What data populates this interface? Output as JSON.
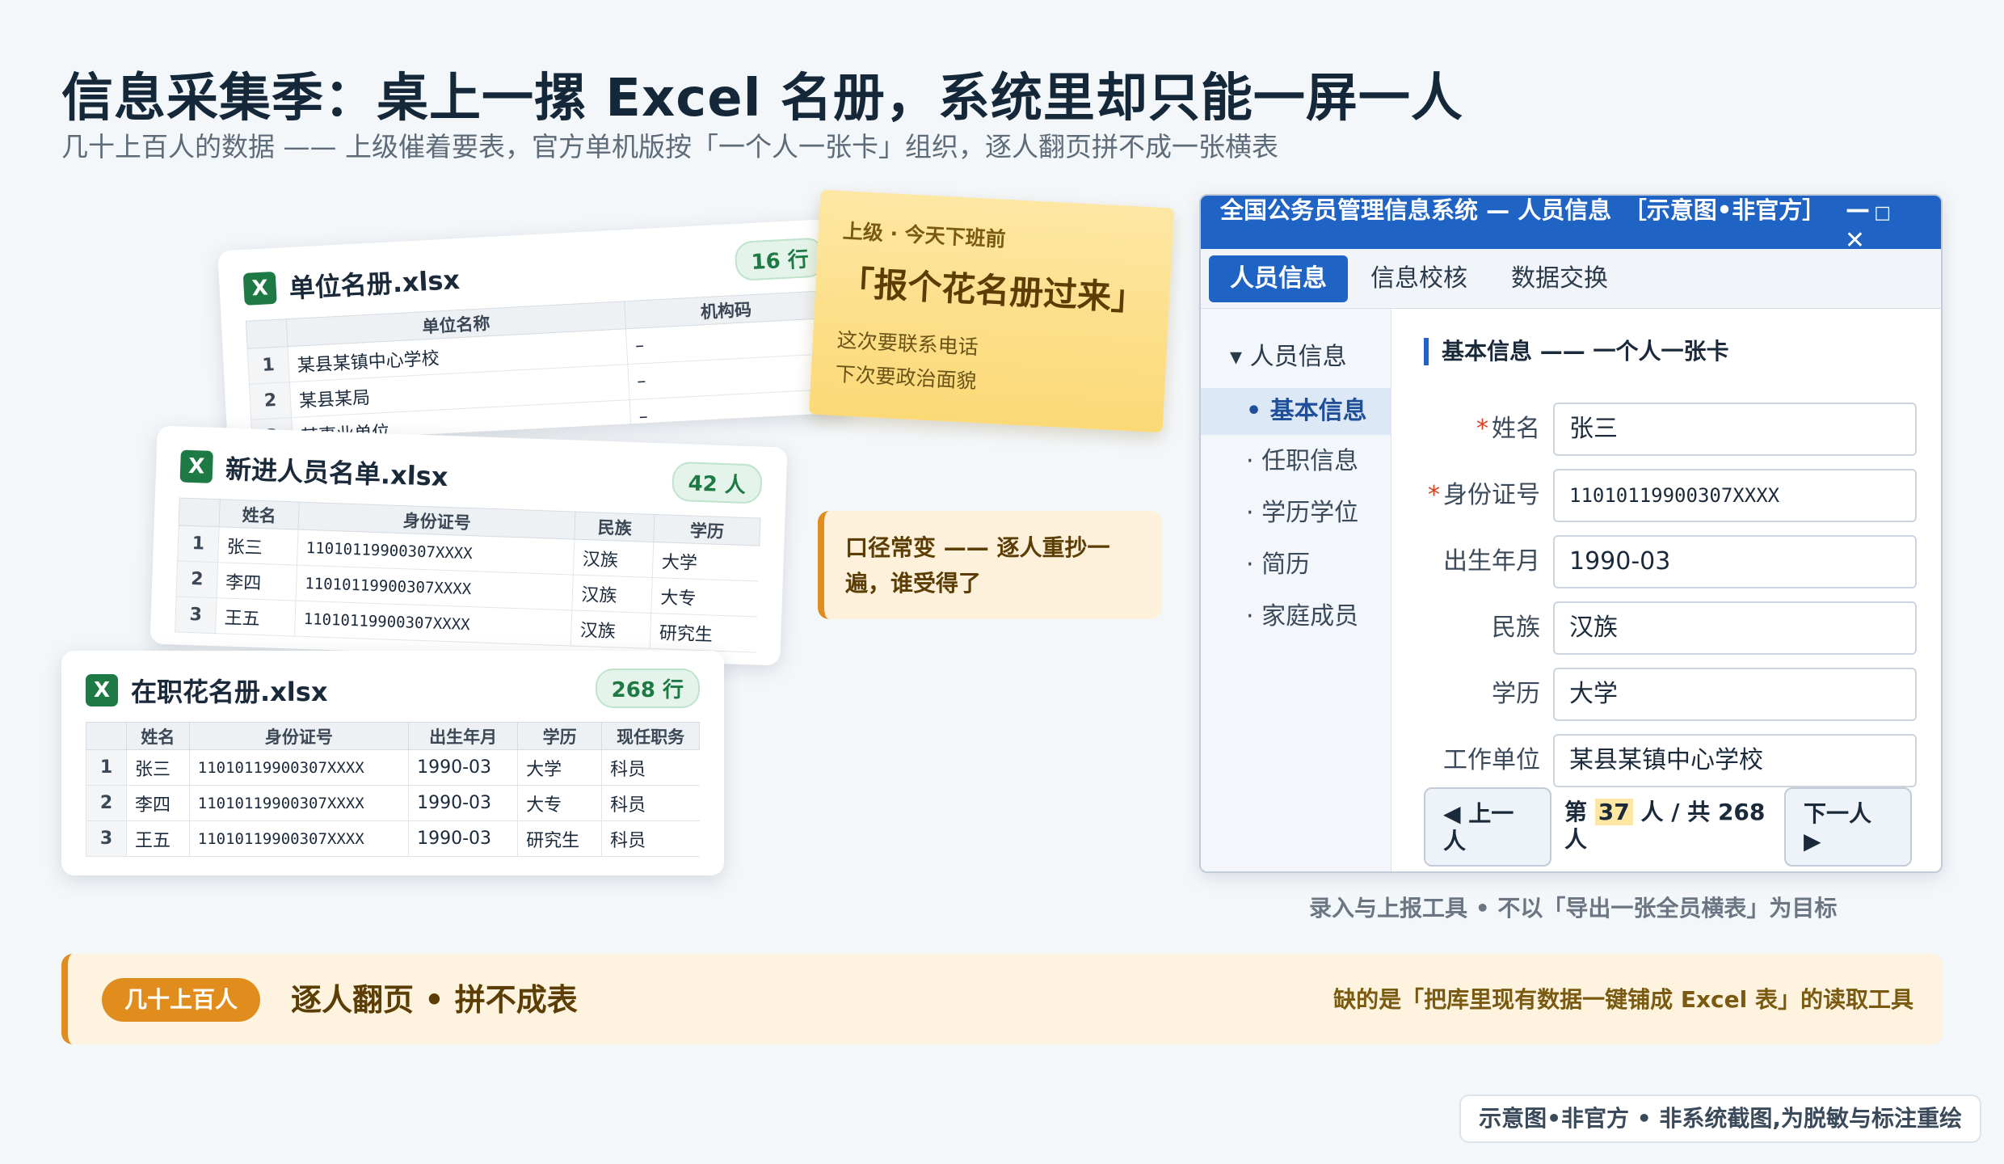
{
  "header": {
    "title": "信息采集季：桌上一摞 Excel 名册，系统里却只能一屏一人",
    "subtitle": "几十上百人的数据 —— 上级催着要表，官方单机版按「一个人一张卡」组织，逐人翻页拼不成一张横表"
  },
  "cards": {
    "unit": {
      "icon": "X",
      "filename": "单位名册.xlsx",
      "count": "16 行",
      "columns": [
        "",
        "单位名称",
        "机构码"
      ],
      "rows": [
        [
          "1",
          "某县某镇中心学校",
          "–"
        ],
        [
          "2",
          "某县某局",
          "–"
        ],
        [
          "3",
          "某事业单位",
          "–"
        ]
      ]
    },
    "newhire": {
      "icon": "X",
      "filename": "新进人员名单.xlsx",
      "count": "42 人",
      "columns": [
        "",
        "姓名",
        "身份证号",
        "民族",
        "学历"
      ],
      "rows": [
        [
          "1",
          "张三",
          "11010119900307XXXX",
          "汉族",
          "大学"
        ],
        [
          "2",
          "李四",
          "11010119900307XXXX",
          "汉族",
          "大专"
        ],
        [
          "3",
          "王五",
          "11010119900307XXXX",
          "汉族",
          "研究生"
        ]
      ]
    },
    "roster": {
      "icon": "X",
      "filename": "在职花名册.xlsx",
      "count": "268 行",
      "columns": [
        "",
        "姓名",
        "身份证号",
        "出生年月",
        "学历",
        "现任职务"
      ],
      "rows": [
        [
          "1",
          "张三",
          "11010119900307XXXX",
          "1990-03",
          "大学",
          "科员"
        ],
        [
          "2",
          "李四",
          "11010119900307XXXX",
          "1990-03",
          "大专",
          "科员"
        ],
        [
          "3",
          "王五",
          "11010119900307XXXX",
          "1990-03",
          "研究生",
          "科员"
        ]
      ]
    }
  },
  "sticky": {
    "from": "上级 · 今天下班前",
    "main": "「报个花名册过来」",
    "line1": "这次要联系电话",
    "line2": "下次要政治面貌"
  },
  "callout": {
    "text": "口径常变 —— 逐人重抄一遍，谁受得了"
  },
  "window": {
    "title": "全国公务员管理信息系统 — 人员信息　［示意图•非官方］",
    "min": "—",
    "max": "□",
    "close": "✕",
    "tabs": [
      "人员信息",
      "信息校核",
      "数据交换"
    ],
    "side_group": "▾ 人员信息",
    "side_items": [
      "• 基本信息",
      "· 任职信息",
      "· 学历学位",
      "· 简历",
      "· 家庭成员"
    ],
    "form_head": "基本信息 —— 一个人一张卡",
    "fields": [
      {
        "label": "姓名",
        "required": "*",
        "value": "张三"
      },
      {
        "label": "身份证号",
        "required": "*",
        "value": "11010119900307XXXX"
      },
      {
        "label": "出生年月",
        "required": "",
        "value": "1990-03"
      },
      {
        "label": "民族",
        "required": "",
        "value": "汉族"
      },
      {
        "label": "学历",
        "required": "",
        "value": "大学"
      },
      {
        "label": "工作单位",
        "required": "",
        "value": "某县某镇中心学校"
      }
    ],
    "pager": {
      "prev": "◀ 上一人",
      "pre": "第 ",
      "current": "37",
      "post": " 人 / 共 268 人",
      "next": "下一人 ▶"
    },
    "caption": "录入与上报工具 • 不以「导出一张全员横表」为目标"
  },
  "banner": {
    "pill": "几十上百人",
    "main": "逐人翻页 • 拼不成表",
    "right": "缺的是「把库里现有数据一键铺成 Excel 表」的读取工具"
  },
  "footnote": "示意图•非官方 • 非系统截图,为脱敏与标注重绘"
}
